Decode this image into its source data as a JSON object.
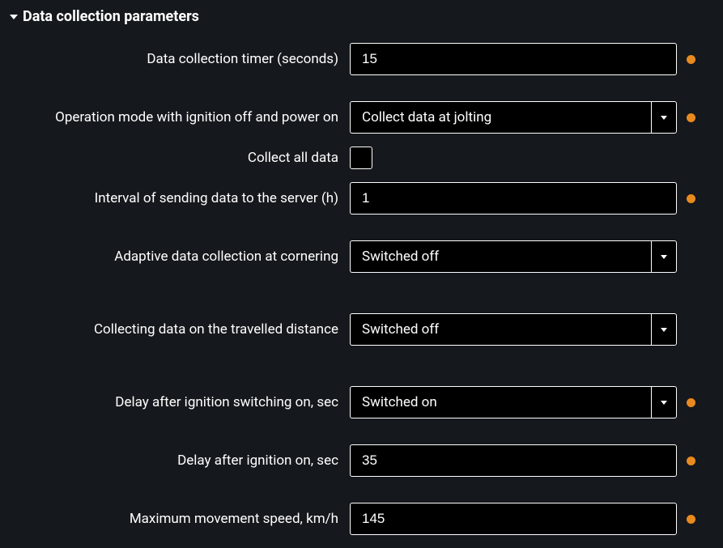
{
  "section": {
    "title": "Data collection parameters"
  },
  "fields": {
    "timer": {
      "label": "Data collection timer (seconds)",
      "value": "15"
    },
    "operationMode": {
      "label": "Operation mode with ignition off and power on",
      "value": "Collect data at jolting"
    },
    "collectAll": {
      "label": "Collect all data"
    },
    "interval": {
      "label": "Interval of sending data to the server (h)",
      "value": "1"
    },
    "adaptive": {
      "label": "Adaptive data collection at cornering",
      "value": "Switched off"
    },
    "travelledDistance": {
      "label": "Collecting data on the travelled distance",
      "value": "Switched off"
    },
    "delaySwitching": {
      "label": "Delay after ignition switching on, sec",
      "value": "Switched on"
    },
    "delayAfter": {
      "label": "Delay after ignition on, sec",
      "value": "35"
    },
    "maxSpeed": {
      "label": "Maximum movement speed, km/h",
      "value": "145"
    }
  }
}
